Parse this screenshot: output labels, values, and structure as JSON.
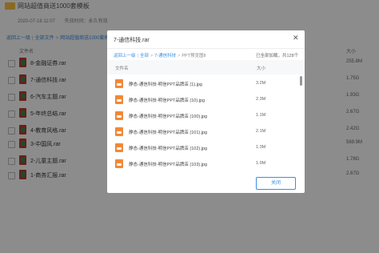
{
  "page": {
    "title": "网站超值商送1000套模板",
    "date": "2020-07-18 11:07",
    "expire": "失效时间：永久有效"
  },
  "breadcrumb": {
    "back": "返回上一级",
    "all": "全部文件",
    "current": "网站超值商送1000套模板"
  },
  "columns": {
    "name": "文件名",
    "size": "大小"
  },
  "files": [
    {
      "name": "8-金融证券.rar",
      "size": "255.8M"
    },
    {
      "name": "7-通信科技.rar",
      "size": "1.75G"
    },
    {
      "name": "6-汽车主题.rar",
      "size": "1.93G"
    },
    {
      "name": "5-年终总结.rar",
      "size": "2.67G"
    },
    {
      "name": "4-教育风格.rar",
      "size": "2.42G"
    },
    {
      "name": "3-中国风.rar",
      "size": "569.9M"
    },
    {
      "name": "2-儿童主题.rar",
      "size": "1.78G"
    },
    {
      "name": "1-商务汇报.rar",
      "size": "2.67G"
    }
  ],
  "modal": {
    "title": "7-通信科技.rar",
    "crumb_back": "返回上一级",
    "crumb_all": "全部",
    "crumb_folder": "7-通信科技",
    "crumb_current": "PPT预览图8",
    "status": "已全部加载，共128个",
    "col_name": "文件名",
    "col_size": "大小",
    "files": [
      {
        "name": "静态-通信科技-明信PPT品牌店 (1).jpg",
        "size": "3.2M"
      },
      {
        "name": "静态-通信科技-明信PPT品牌店 (10).jpg",
        "size": "2.3M"
      },
      {
        "name": "静态-通信科技-明信PPT品牌店 (100).jpg",
        "size": "1.1M"
      },
      {
        "name": "静态-通信科技-明信PPT品牌店 (101).jpg",
        "size": "2.1M"
      },
      {
        "name": "静态-通信科技-明信PPT品牌店 (102).jpg",
        "size": "1.3M"
      },
      {
        "name": "静态-通信科技-明信PPT品牌店 (103).jpg",
        "size": "1.9M"
      }
    ],
    "close_label": "关闭"
  }
}
